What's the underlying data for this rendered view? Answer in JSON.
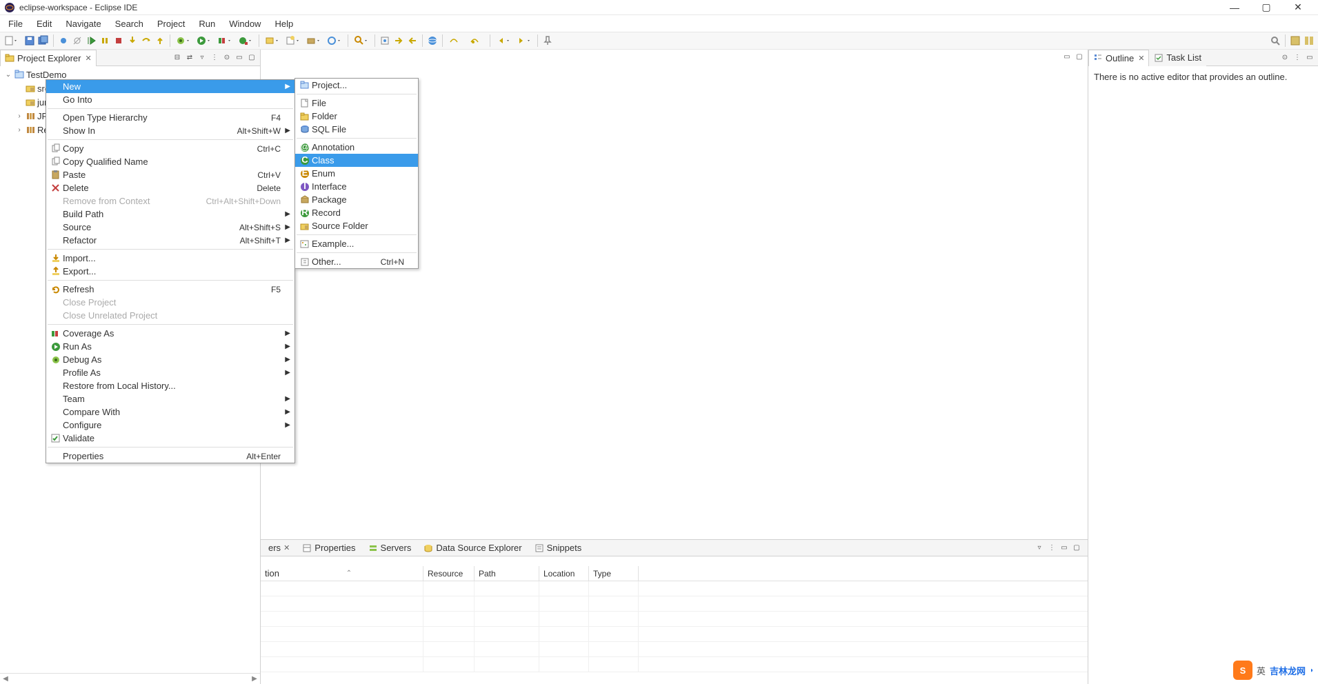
{
  "window": {
    "title": "eclipse-workspace - Eclipse IDE"
  },
  "menubar": [
    "File",
    "Edit",
    "Navigate",
    "Search",
    "Project",
    "Run",
    "Window",
    "Help"
  ],
  "projectExplorer": {
    "tabLabel": "Project Explorer",
    "tree": {
      "project": "TestDemo",
      "children": [
        "src",
        "jun",
        "JRE",
        "Re"
      ]
    }
  },
  "contextMenu": {
    "items": [
      {
        "label": "New",
        "submenu": true,
        "highlight": true
      },
      {
        "label": "Go Into"
      },
      {
        "sep": true
      },
      {
        "label": "Open Type Hierarchy",
        "accel": "F4"
      },
      {
        "label": "Show In",
        "accel": "Alt+Shift+W",
        "submenu": true
      },
      {
        "sep": true
      },
      {
        "label": "Copy",
        "accel": "Ctrl+C",
        "icon": "copy"
      },
      {
        "label": "Copy Qualified Name",
        "icon": "copy"
      },
      {
        "label": "Paste",
        "accel": "Ctrl+V",
        "icon": "paste"
      },
      {
        "label": "Delete",
        "accel": "Delete",
        "icon": "delete"
      },
      {
        "label": "Remove from Context",
        "accel": "Ctrl+Alt+Shift+Down",
        "disabled": true
      },
      {
        "label": "Build Path",
        "submenu": true
      },
      {
        "label": "Source",
        "accel": "Alt+Shift+S",
        "submenu": true
      },
      {
        "label": "Refactor",
        "accel": "Alt+Shift+T",
        "submenu": true
      },
      {
        "sep": true
      },
      {
        "label": "Import...",
        "icon": "import"
      },
      {
        "label": "Export...",
        "icon": "export"
      },
      {
        "sep": true
      },
      {
        "label": "Refresh",
        "accel": "F5",
        "icon": "refresh"
      },
      {
        "label": "Close Project",
        "disabled": true
      },
      {
        "label": "Close Unrelated Project",
        "disabled": true
      },
      {
        "sep": true
      },
      {
        "label": "Coverage As",
        "submenu": true,
        "icon": "coverage"
      },
      {
        "label": "Run As",
        "submenu": true,
        "icon": "run"
      },
      {
        "label": "Debug As",
        "submenu": true,
        "icon": "debug"
      },
      {
        "label": "Profile As",
        "submenu": true
      },
      {
        "label": "Restore from Local History..."
      },
      {
        "label": "Team",
        "submenu": true
      },
      {
        "label": "Compare With",
        "submenu": true
      },
      {
        "label": "Configure",
        "submenu": true
      },
      {
        "label": "Validate",
        "icon": "check"
      },
      {
        "sep": true
      },
      {
        "label": "Properties",
        "accel": "Alt+Enter"
      }
    ]
  },
  "newSubmenu": {
    "items": [
      {
        "label": "Project...",
        "icon": "project"
      },
      {
        "sep": true
      },
      {
        "label": "File",
        "icon": "file"
      },
      {
        "label": "Folder",
        "icon": "folder"
      },
      {
        "label": "SQL File",
        "icon": "sql"
      },
      {
        "sep": true
      },
      {
        "label": "Annotation",
        "icon": "annotation"
      },
      {
        "label": "Class",
        "icon": "class",
        "highlight": true
      },
      {
        "label": "Enum",
        "icon": "enum"
      },
      {
        "label": "Interface",
        "icon": "interface"
      },
      {
        "label": "Package",
        "icon": "package"
      },
      {
        "label": "Record",
        "icon": "record"
      },
      {
        "label": "Source Folder",
        "icon": "srcfolder"
      },
      {
        "sep": true
      },
      {
        "label": "Example...",
        "icon": "example"
      },
      {
        "sep": true
      },
      {
        "label": "Other...",
        "accel": "Ctrl+N",
        "icon": "other"
      }
    ]
  },
  "outline": {
    "tabLabel": "Outline",
    "taskListLabel": "Task List",
    "emptyMessage": "There is no active editor that provides an outline."
  },
  "bottomTabs": {
    "markersFragment": "ers",
    "properties": "Properties",
    "servers": "Servers",
    "dataSource": "Data Source Explorer",
    "snippets": "Snippets"
  },
  "tableHeaders": {
    "description": "tion",
    "resource": "Resource",
    "path": "Path",
    "location": "Location",
    "type": "Type"
  },
  "watermark": {
    "badge": "S",
    "lang": "英",
    "site": "吉林龙网"
  }
}
